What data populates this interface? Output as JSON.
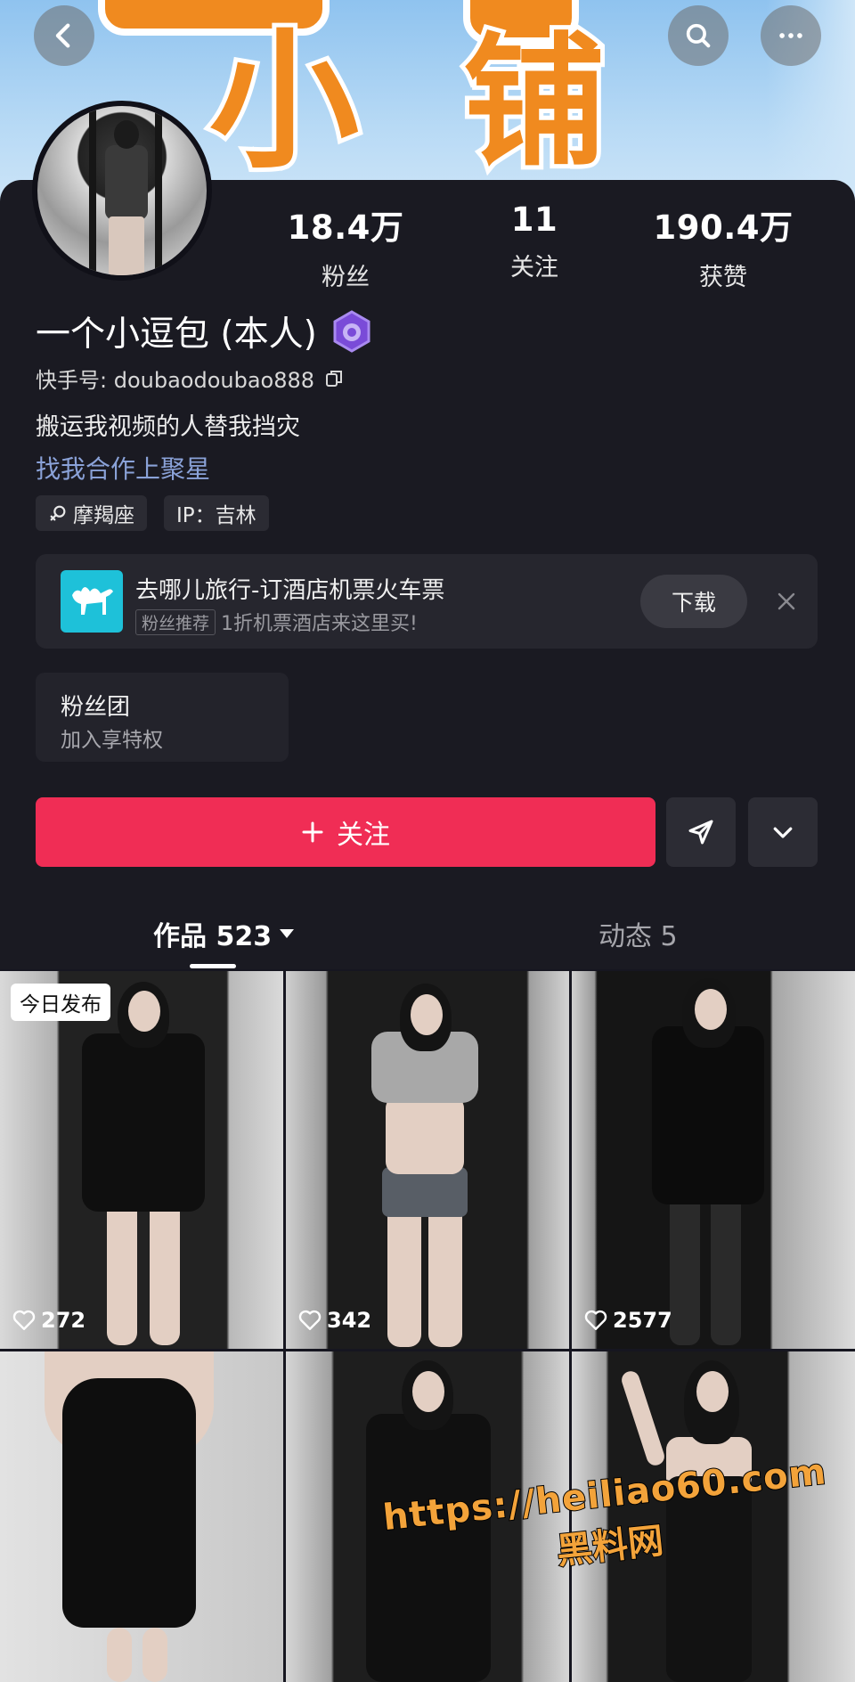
{
  "banner": {
    "text_a": "小",
    "text_b": "铺"
  },
  "header": {
    "back_icon": "chevron-left-icon",
    "search_icon": "search-icon",
    "more_icon": "ellipsis-icon"
  },
  "profile": {
    "stats": [
      {
        "value": "18.4万",
        "label": "粉丝"
      },
      {
        "value": "11",
        "label": "关注"
      },
      {
        "value": "190.4万",
        "label": "获赞"
      }
    ],
    "name": "一个小逗包 (本人)",
    "uid": "快手号: doubaodoubao888",
    "bio": "搬运我视频的人替我挡灾",
    "link": "找我合作上聚星",
    "tags": [
      "摩羯座",
      "IP：吉林"
    ]
  },
  "ad": {
    "title": "去哪儿旅行-订酒店机票火车票",
    "chip": "粉丝推荐",
    "subtitle": "1折机票酒店来这里买!",
    "download": "下载"
  },
  "fanclub": {
    "title": "粉丝团",
    "subtitle": "加入享特权"
  },
  "actions": {
    "follow": "关注"
  },
  "tabs": [
    {
      "label": "作品 523"
    },
    {
      "label": "动态 5"
    }
  ],
  "grid": {
    "today_badge": "今日发布",
    "items": [
      {
        "likes": "272"
      },
      {
        "likes": "342"
      },
      {
        "likes": "2577"
      },
      {
        "likes": ""
      },
      {
        "likes": ""
      },
      {
        "likes": ""
      }
    ]
  },
  "watermark": {
    "url": "https://heiliao60.com",
    "text": "黑料网"
  },
  "colors": {
    "accent": "#f02d55",
    "link": "#8aa2d8",
    "background": "#161620"
  }
}
